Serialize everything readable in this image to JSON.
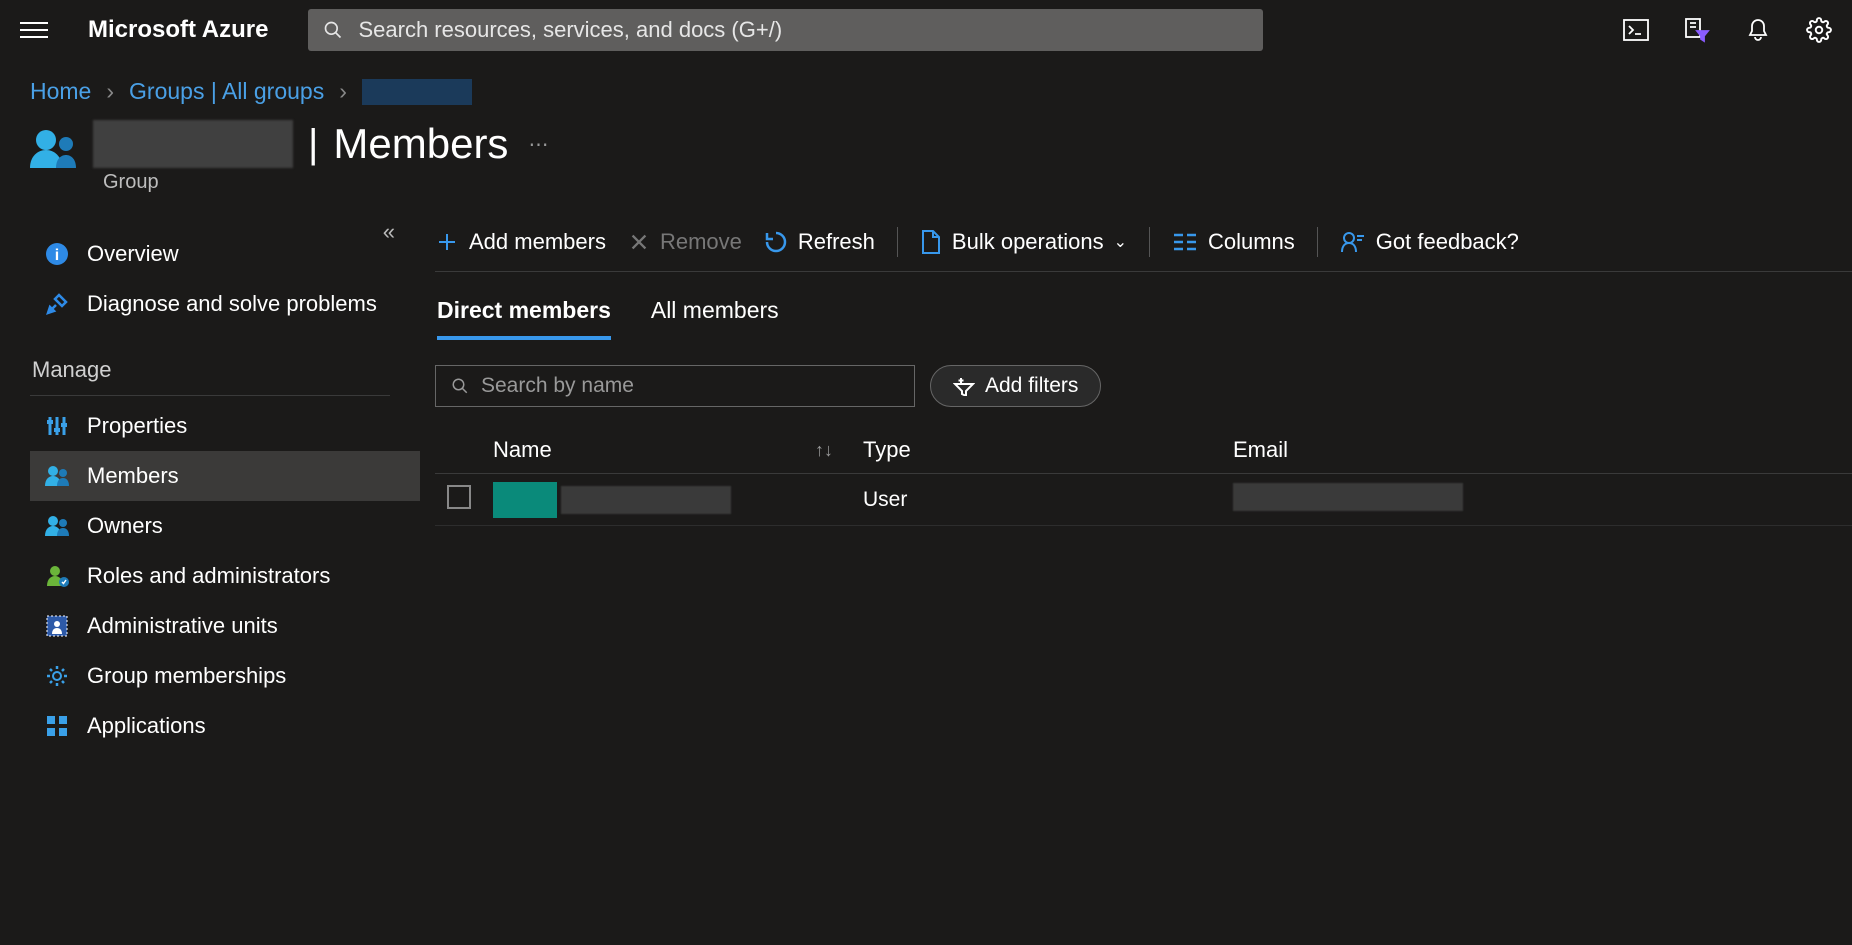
{
  "brand": "Microsoft Azure",
  "search": {
    "placeholder": "Search resources, services, and docs (G+/)"
  },
  "breadcrumbs": {
    "home": "Home",
    "groups": "Groups | All groups"
  },
  "header": {
    "title": "Members",
    "subtitle": "Group"
  },
  "sidebar": {
    "overview": "Overview",
    "diagnose": "Diagnose and solve problems",
    "manage_head": "Manage",
    "properties": "Properties",
    "members": "Members",
    "owners": "Owners",
    "roles": "Roles and administrators",
    "admin_units": "Administrative units",
    "group_memb": "Group memberships",
    "applications": "Applications"
  },
  "toolbar": {
    "add": "Add members",
    "remove": "Remove",
    "refresh": "Refresh",
    "bulk": "Bulk operations",
    "columns": "Columns",
    "feedback": "Got feedback?"
  },
  "tabs": {
    "direct": "Direct members",
    "all": "All members"
  },
  "filter": {
    "search_placeholder": "Search by name",
    "add_filters": "Add filters"
  },
  "table": {
    "cols": {
      "name": "Name",
      "type": "Type",
      "email": "Email"
    },
    "rows": [
      {
        "type": "User"
      }
    ]
  }
}
